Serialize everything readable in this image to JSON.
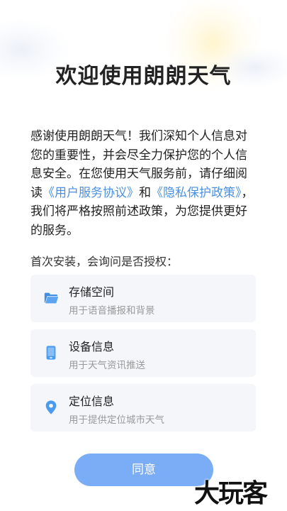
{
  "dialog": {
    "title": "欢迎使用朗朗天气",
    "intro": {
      "part1": "感谢使用朗朗天气！我们深知个人信息对您的重要性，并会尽全力保护您的个人信息安全。在您使用天气服务前，请仔细阅读",
      "user_agreement_link": "《用户服务协议》",
      "and": "和",
      "privacy_policy_link": "《隐私保护政策》",
      "part2": "，我们将严格按照前述政策，为您提供更好的服务。"
    },
    "permissions_heading": "首次安装，会询问是否授权：",
    "permissions": [
      {
        "name": "存储空间",
        "desc": "用于语音播报和背景",
        "icon": "folder-icon"
      },
      {
        "name": "设备信息",
        "desc": "用于天气资讯推送",
        "icon": "phone-icon"
      },
      {
        "name": "定位信息",
        "desc": "用于提供定位城市天气",
        "icon": "location-pin-icon"
      }
    ],
    "agree_label": "同意"
  },
  "watermark": "大玩客",
  "colors": {
    "accent": "#4a90e2",
    "button": "#7aadf6",
    "card_bg": "#f4f6f9"
  }
}
